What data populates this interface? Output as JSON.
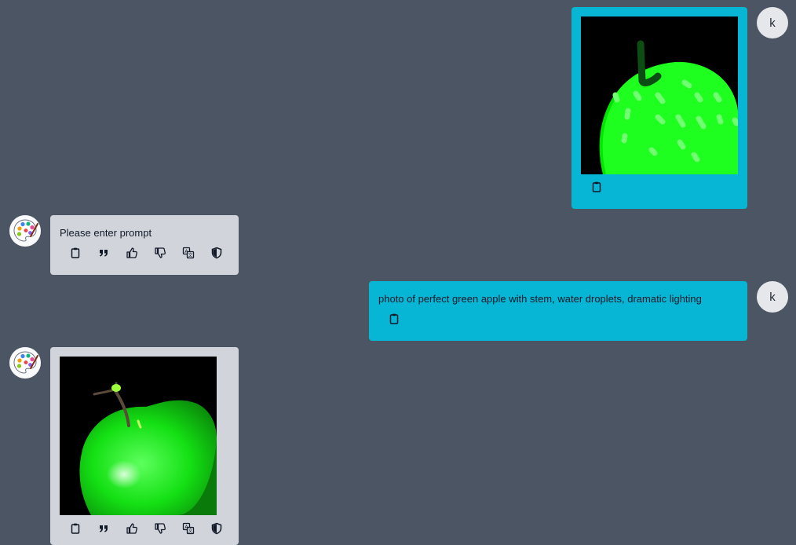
{
  "colors": {
    "background": "#4b5563",
    "user_bubble": "#06b6d4",
    "bot_bubble": "#d1d5db",
    "user_avatar": "#e5e7eb"
  },
  "messages": [
    {
      "role": "user",
      "avatar_letter": "k",
      "content_type": "image",
      "image_icon": "green-apple-sketch",
      "actions": [
        "clipboard-icon"
      ]
    },
    {
      "role": "bot",
      "avatar_icon": "palette-icon",
      "content_type": "text",
      "text": "Please enter prompt",
      "actions": [
        "clipboard-icon",
        "quote-icon",
        "thumbs-up-icon",
        "thumbs-down-icon",
        "translate-icon",
        "shield-icon"
      ]
    },
    {
      "role": "user",
      "avatar_letter": "k",
      "content_type": "text",
      "text": "photo of perfect green apple with stem, water droplets, dramatic lighting",
      "actions": [
        "clipboard-icon"
      ]
    },
    {
      "role": "bot",
      "avatar_icon": "palette-icon",
      "content_type": "image",
      "image_icon": "green-apple-render",
      "actions": [
        "clipboard-icon",
        "quote-icon",
        "thumbs-up-icon",
        "thumbs-down-icon",
        "translate-icon",
        "shield-icon"
      ]
    }
  ]
}
